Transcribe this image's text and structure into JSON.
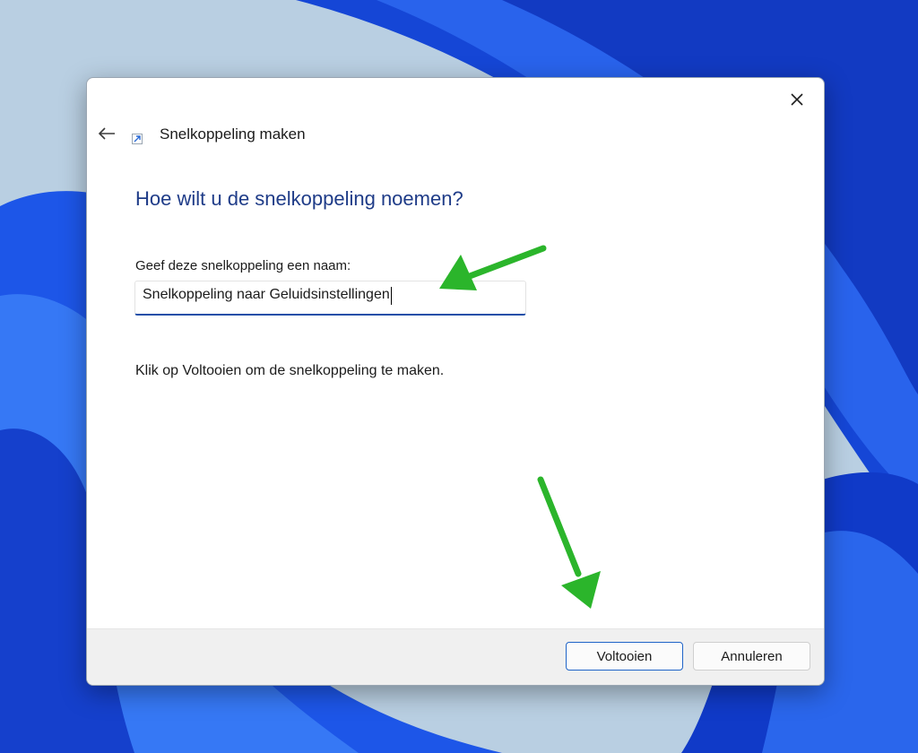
{
  "dialog": {
    "title": "Snelkoppeling maken",
    "heading": "Hoe wilt u de snelkoppeling noemen?",
    "name_label": "Geef deze snelkoppeling een naam:",
    "name_value": "Snelkoppeling naar Geluidsinstellingen",
    "info": "Klik op Voltooien om de snelkoppeling te maken.",
    "finish_label": "Voltooien",
    "cancel_label": "Annuleren"
  },
  "icons": {
    "close": "close-icon",
    "back": "back-arrow-icon",
    "wizard": "shortcut-icon",
    "annotation": "green-arrow-icon"
  },
  "colors": {
    "heading": "#1f3c88",
    "input_underline": "#1f4fa8",
    "primary_border": "#1f64c8",
    "annotation": "#2bb52b",
    "wallpaper": "#1a4fe0"
  }
}
